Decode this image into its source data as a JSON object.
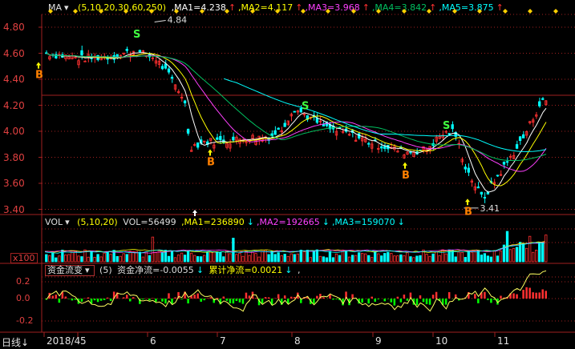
{
  "main": {
    "ma_button": "MA",
    "params": "(5,10,20,30,60,250)",
    "ma": [
      {
        "label": "MA1=4.238",
        "arrow": "↑",
        "color": "#ffffff"
      },
      {
        "label": "MA2=4.117",
        "arrow": "↑",
        "color": "#ffff00"
      },
      {
        "label": "MA3=3.968",
        "arrow": "↑",
        "color": "#ff40ff"
      },
      {
        "label": "MA4=3.842",
        "arrow": "↑",
        "color": "#00c060"
      },
      {
        "label": "MA5=3.875",
        "arrow": "↑",
        "color": "#00ffff"
      }
    ],
    "y_ticks": [
      "4.80",
      "4.60",
      "4.40",
      "4.20",
      "4.00",
      "3.80",
      "3.60",
      "3.40"
    ],
    "high_label": "4.84",
    "low_label": "3.41",
    "buy_marker": "B",
    "sell_marker": "S"
  },
  "volume": {
    "button": "VOL",
    "params": "(5,10,20)",
    "vol": "VOL=56499",
    "ma": [
      {
        "label": "MA1=236890",
        "arrow": "↓",
        "color": "#ffff00"
      },
      {
        "label": "MA2=192665",
        "arrow": "↓",
        "color": "#ff40ff"
      },
      {
        "label": "MA3=159070",
        "arrow": "↓",
        "color": "#00ffff"
      }
    ],
    "unit": "x100"
  },
  "fund": {
    "button": "资金流变",
    "param": "(5)",
    "net": "资金净流=-0.0055",
    "net_arrow": "↓",
    "cum": "累计净流=0.0021",
    "cum_arrow": "↓",
    "tail": ",",
    "y_ticks": [
      "0.2",
      "0.0",
      "-0.2"
    ]
  },
  "xaxis": {
    "period": "日线",
    "period_arrow": "↓",
    "labels": [
      "2018/4",
      "5",
      "6",
      "7",
      "8",
      "9",
      "10",
      "11"
    ]
  },
  "colors": {
    "up": "#ff3030",
    "down": "#00ffff",
    "grid": "#a02020",
    "axis_text": "#e04040"
  }
}
